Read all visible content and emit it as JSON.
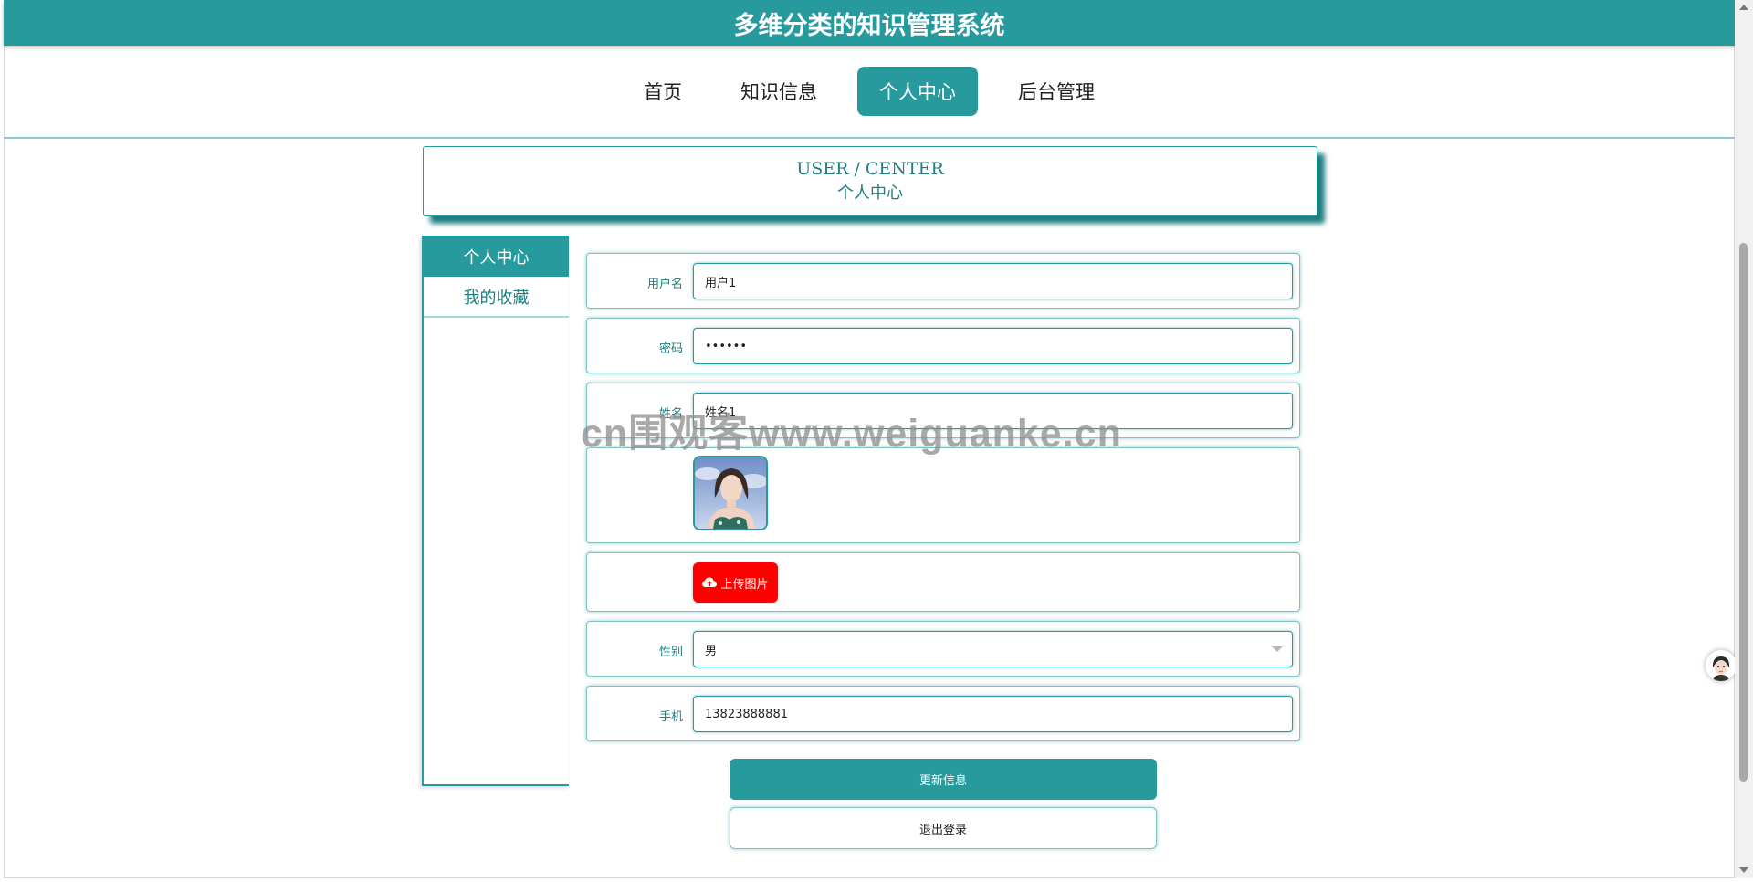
{
  "app": {
    "title": "多维分类的知识管理系统"
  },
  "nav": {
    "items": [
      {
        "label": "首页"
      },
      {
        "label": "知识信息"
      },
      {
        "label": "个人中心"
      },
      {
        "label": "后台管理"
      }
    ],
    "active": "个人中心"
  },
  "banner": {
    "en": "USER / CENTER",
    "cn": "个人中心"
  },
  "sidebar": {
    "items": [
      {
        "label": "个人中心"
      },
      {
        "label": "我的收藏"
      }
    ]
  },
  "form": {
    "username": {
      "label": "用户名",
      "value": "用户1"
    },
    "password": {
      "label": "密码",
      "value": "••••••"
    },
    "name": {
      "label": "姓名",
      "value": "姓名1"
    },
    "avatar": {
      "alt": "avatar-photo"
    },
    "upload": {
      "label": "上传图片",
      "icon": "cloud-upload-icon"
    },
    "gender": {
      "label": "性别",
      "value": "男"
    },
    "phone": {
      "label": "手机",
      "value": "13823888881"
    }
  },
  "buttons": {
    "update": "更新信息",
    "logout": "退出登录"
  },
  "watermark": {
    "text": "cn围观客www.weiguanke.cn"
  },
  "colors": {
    "primary": "#279a9d",
    "upload": "#ff0000"
  }
}
